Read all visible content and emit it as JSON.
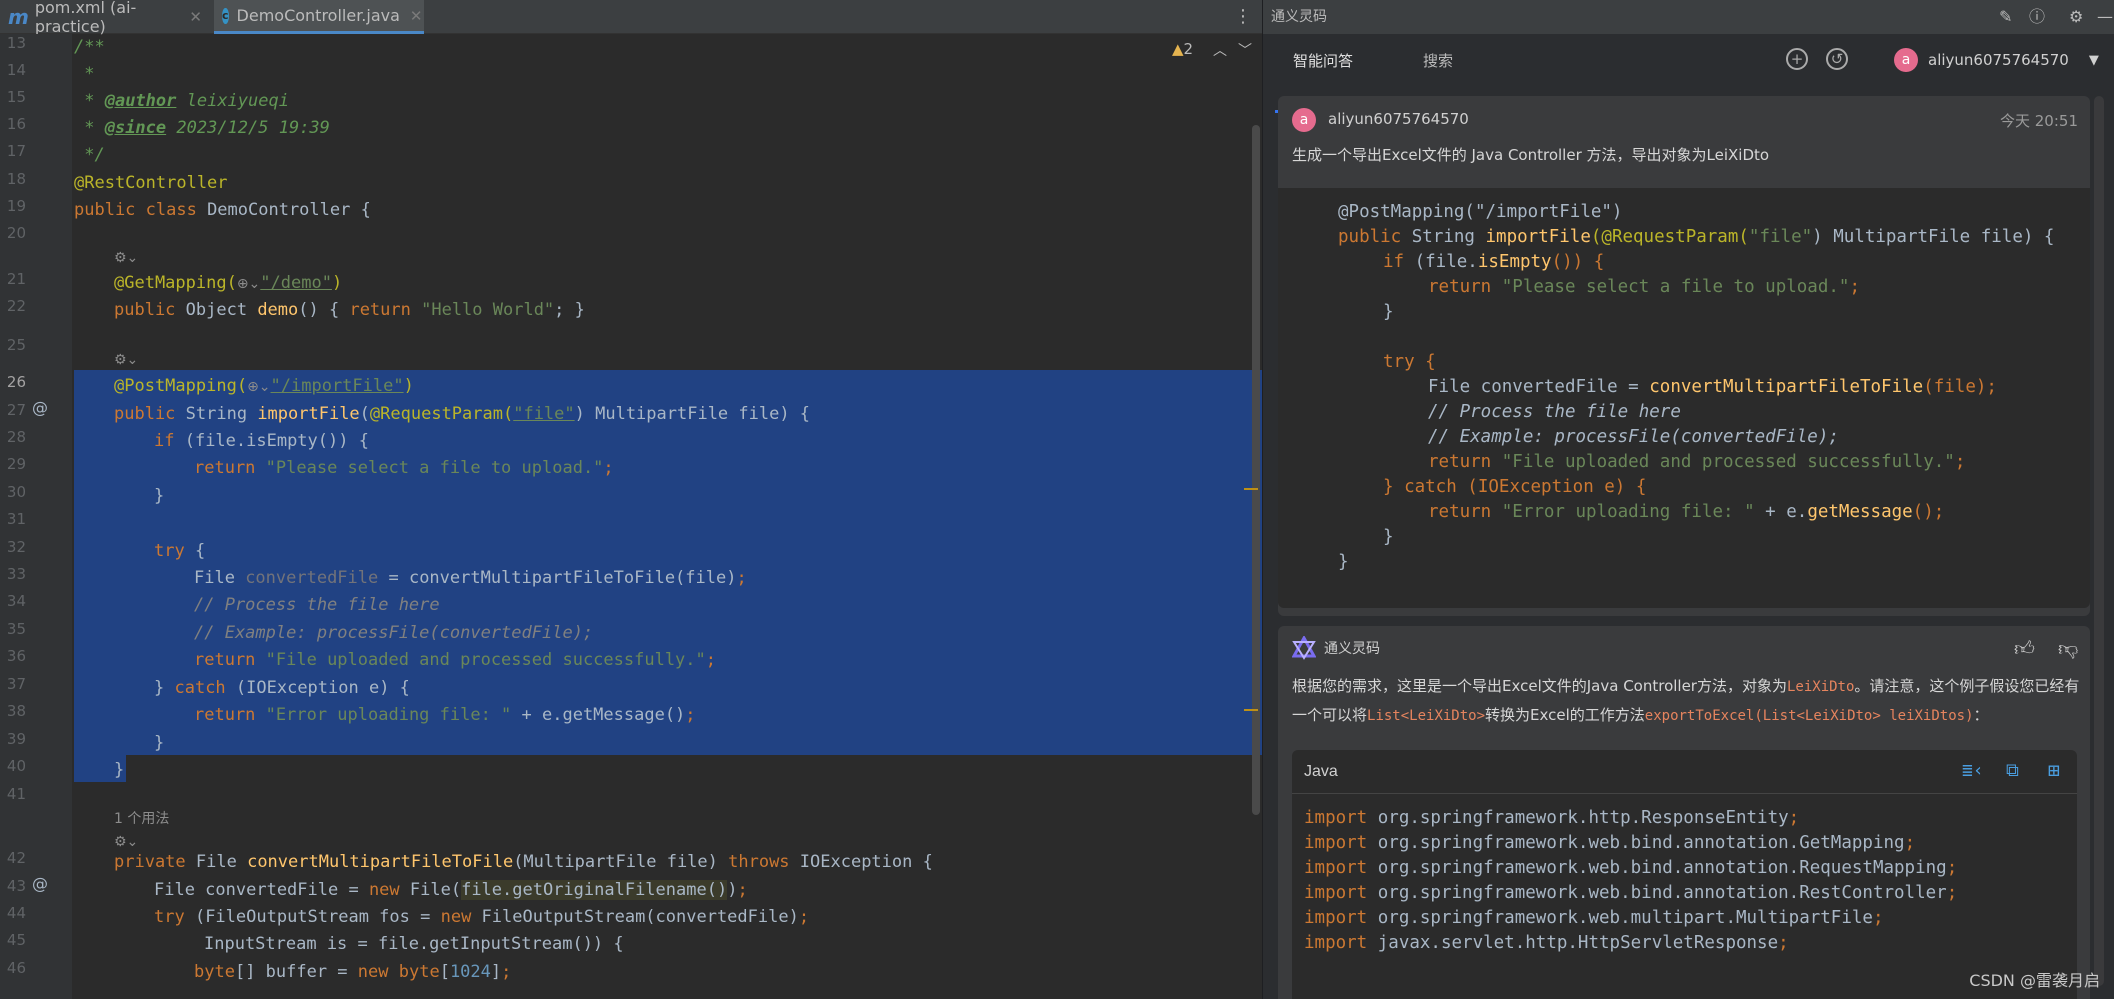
{
  "tabs": [
    {
      "label": "pom.xml (ai-practice)",
      "icon": "m"
    },
    {
      "label": "DemoController.java",
      "icon": "c"
    }
  ],
  "editor": {
    "warning_count": "2",
    "line_numbers": [
      "13",
      "14",
      "15",
      "16",
      "17",
      "18",
      "19",
      "20",
      "21",
      "22",
      "25",
      "26",
      "27",
      "28",
      "29",
      "30",
      "31",
      "32",
      "33",
      "34",
      "35",
      "36",
      "37",
      "38",
      "39",
      "40",
      "41",
      "42",
      "43",
      "44",
      "45",
      "46"
    ],
    "usage_hint": "1 个用法",
    "code": {
      "l13": "/**",
      "l14": " *",
      "l15_tag": "@author",
      "l15_val": " leixiyueqi",
      "l16_tag": "@since",
      "l16_val": " 2023/12/5 19:39",
      "l17": " */",
      "l18": "@RestController",
      "l19_kw": "public class",
      "l19_name": " DemoController {",
      "l21_ann": "@GetMapping(",
      "l21_str": "\"/demo\"",
      "l21_end": ")",
      "l22_kw": "public",
      "l22_type": " Object ",
      "l22_fn": "demo",
      "l22_rest": "() { ",
      "l22_ret": "return",
      "l22_str": " \"Hello World\"",
      "l22_end": "; }",
      "l26_ann": "@PostMapping(",
      "l26_str": "\"/importFile\"",
      "l26_end": ")",
      "l27_kw": "public",
      "l27_type": " String ",
      "l27_fn": "importFile",
      "l27_p1": "(",
      "l27_ann": "@RequestParam(",
      "l27_str": "\"file\"",
      "l27_rest": ") MultipartFile file) {",
      "l28_kw": "if",
      "l28_rest": " (file.isEmpty()) {",
      "l29_kw": "return",
      "l29_str": " \"Please select a file to upload.\"",
      "l29_end": ";",
      "l30": "}",
      "l32_kw": "try",
      "l32_rest": " {",
      "l33_type": "File ",
      "l33_var": "convertedFile",
      "l33_rest": " = convertMultipartFileToFile(file)",
      "l33_end": ";",
      "l34": "// Process the file here",
      "l35": "// Example: processFile(convertedFile);",
      "l36_kw": "return",
      "l36_str": " \"File uploaded and processed successfully.\"",
      "l36_end": ";",
      "l37_a": "} ",
      "l37_kw": "catch",
      "l37_rest": " (IOException e) {",
      "l38_kw": "return",
      "l38_str": " \"Error uploading file: \"",
      "l38_rest": " + e.getMessage()",
      "l38_end": ";",
      "l39": "}",
      "l40": "}",
      "l42_kw": "private",
      "l42_type": " File ",
      "l42_fn": "convertMultipartFileToFile",
      "l42_rest": "(MultipartFile file) ",
      "l42_kw2": "throws",
      "l42_end": " IOException {",
      "l43_type": "File convertedFile = ",
      "l43_kw": "new",
      "l43_rest": " File(",
      "l43_hl": "file.getOriginalFilename()",
      "l43_end": ")",
      "l43_semi": ";",
      "l44_kw": "try",
      "l44_rest": " (FileOutputStream fos = ",
      "l44_kw2": "new",
      "l44_end": " FileOutputStream(convertedFile)",
      "l44_semi": ";",
      "l45": "InputStream is = file.getInputStream()) {",
      "l46_kw": "byte",
      "l46_rest": "[] buffer = ",
      "l46_kw2": "new",
      "l46_kw3": " byte",
      "l46_b": "[",
      "l46_num": "1024",
      "l46_end": "]",
      "l46_semi": ";"
    }
  },
  "panel": {
    "title": "通义灵码",
    "tabs": [
      "智能问答",
      "搜索"
    ],
    "user": "aliyun6075764570",
    "avatar_letter": "a",
    "question": {
      "user": "aliyun6075764570",
      "time": "今天 20:51",
      "text": "生成一个导出Excel文件的 Java Controller 方法，导出对象为LeiXiDto"
    },
    "quoted_code": {
      "l1": "@PostMapping(\"/importFile\")",
      "l2_kw": "public",
      "l2_type": " String ",
      "l2_fn": "importFile",
      "l2_p": "(@RequestParam(",
      "l2_str": "\"file\"",
      "l2_rest": ") MultipartFile file) {",
      "l3_kw": "if",
      "l3_rest": " (file.",
      "l3_fn": "isEmpty",
      "l3_end": "()) {",
      "l4_kw": "return",
      "l4_str": " \"Please select a file to upload.\"",
      "l4_end": ";",
      "l5": "}",
      "l7_kw": "try",
      "l7_rest": " {",
      "l8_a": "File convertedFile = ",
      "l8_fn": "convertMultipartFileToFile",
      "l8_rest": "(file);",
      "l9": "// Process the file here",
      "l10": "// Example: processFile(convertedFile);",
      "l11_kw": "return",
      "l11_str": " \"File uploaded and processed successfully.\"",
      "l11_end": ";",
      "l12_a": "} ",
      "l12_kw": "catch",
      "l12_rest": " (IOException e) {",
      "l13_kw": "return",
      "l13_str": " \"Error uploading file: \"",
      "l13_rest": " + e.",
      "l13_fn": "getMessage",
      "l13_end": "();",
      "l14": "}",
      "l15": "}"
    },
    "answer": {
      "bot_name": "通义灵码",
      "text_a": "根据您的需求，这里是一个导出Excel文件的Java Controller方法，对象为",
      "code_a": "LeiXiDto",
      "text_b": "。请注意，这个例子假设您已经有一个可以将",
      "code_b": "List<LeiXiDto>",
      "text_c": "转换为Excel的工作方法",
      "code_c": "exportToExcel(List<LeiXiDto> leiXiDtos)",
      "text_d": "：",
      "lang": "Java",
      "imports": [
        {
          "kw": "import",
          "pkg": " org.springframework.http.ResponseEntity",
          "semi": ";"
        },
        {
          "kw": "import",
          "pkg": " org.springframework.web.bind.annotation.GetMapping",
          "semi": ";"
        },
        {
          "kw": "import",
          "pkg": " org.springframework.web.bind.annotation.RequestMapping",
          "semi": ";"
        },
        {
          "kw": "import",
          "pkg": " org.springframework.web.bind.annotation.RestController",
          "semi": ";"
        },
        {
          "kw": "import",
          "pkg": " org.springframework.web.multipart.MultipartFile",
          "semi": ";"
        },
        {
          "kw": "import",
          "pkg": " javax.servlet.http.HttpServletResponse",
          "semi": ";"
        }
      ]
    }
  },
  "watermark": "CSDN @雷袭月启"
}
